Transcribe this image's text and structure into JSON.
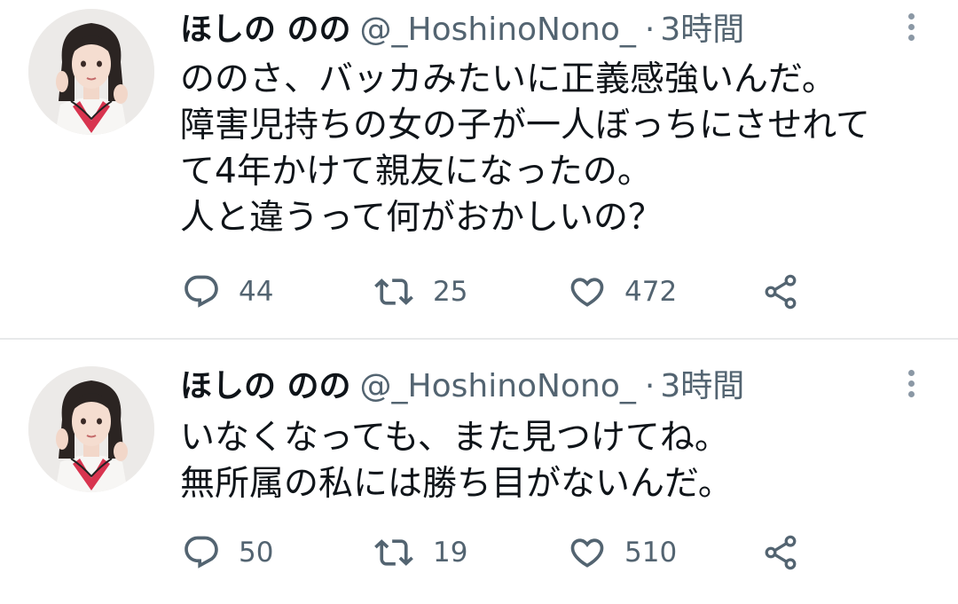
{
  "tweets": [
    {
      "display_name": "ほしの のの",
      "handle": "@_HoshinoNono_",
      "separator": "·",
      "time": "3時間",
      "lines": [
        "ののさ、バッカみたいに正義感強いんだ。",
        "障害児持ちの女の子が一人ぼっちにさせれて",
        "て4年かけて親友になったの。",
        "人と違うって何がおかしいの？"
      ],
      "replies": "44",
      "retweets": "25",
      "likes": "472"
    },
    {
      "display_name": "ほしの のの",
      "handle": "@_HoshinoNono_",
      "separator": "·",
      "time": "3時間",
      "lines": [
        "いなくなっても、また見つけてね。",
        "無所属の私には勝ち目がないんだ。"
      ],
      "replies": "50",
      "retweets": "19",
      "likes": "510"
    }
  ],
  "icons": {
    "reply": "reply-icon",
    "retweet": "retweet-icon",
    "like": "heart-icon",
    "share": "share-icon",
    "more": "more-icon"
  },
  "colors": {
    "text": "#0f1419",
    "secondary": "#536471",
    "divider": "#e7e9ea",
    "avatar_ribbon": "#d8344f"
  }
}
